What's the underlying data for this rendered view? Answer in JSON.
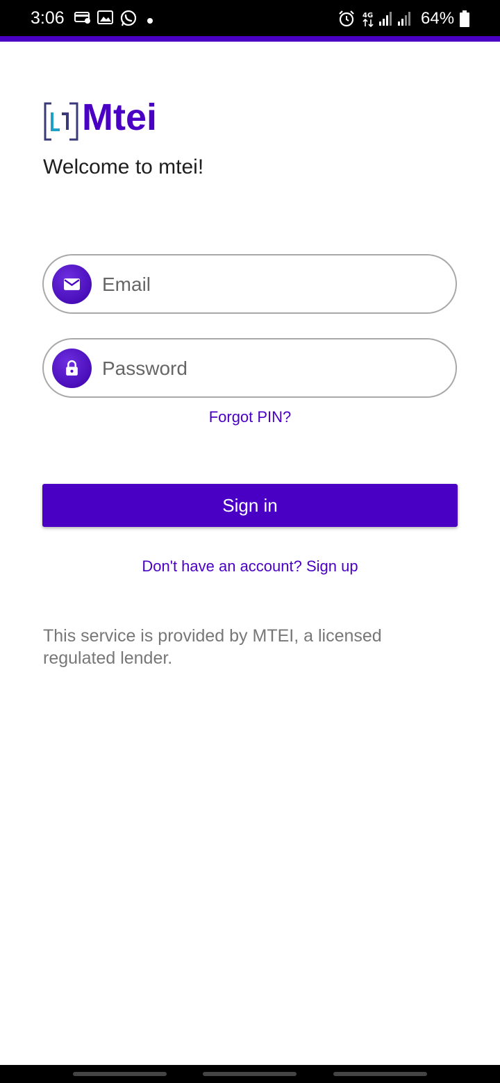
{
  "status_bar": {
    "time": "3:06",
    "battery": "64%",
    "icons_left": [
      "payment-icon",
      "image-icon",
      "whatsapp-icon",
      "dot-icon"
    ],
    "icons_right": [
      "alarm-icon",
      "4g-icon",
      "signal-icon",
      "signal-icon",
      "battery-icon"
    ]
  },
  "app": {
    "logo_text": "Mtei",
    "welcome": "Welcome to mtei!",
    "brand_color": "#4a00c4"
  },
  "form": {
    "email": {
      "placeholder": "Email",
      "value": "",
      "icon": "mail-icon"
    },
    "password": {
      "placeholder": "Password",
      "value": "",
      "icon": "lock-icon"
    },
    "forgot_label": "Forgot PIN?",
    "signin_label": "Sign in",
    "signup_label": "Don't have an account? Sign up"
  },
  "disclaimer": "This service is provided by MTEI, a licensed regulated lender."
}
